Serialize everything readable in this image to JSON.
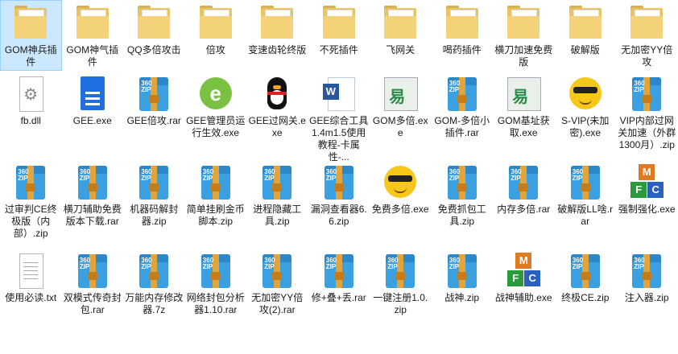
{
  "files": [
    {
      "label": "GOM神兵插件",
      "icon": "folder-icon",
      "selected": true
    },
    {
      "label": "GOM神气插件",
      "icon": "folder-icon",
      "selected": false
    },
    {
      "label": "QQ多倍攻击",
      "icon": "folder-icon",
      "selected": false
    },
    {
      "label": "倍攻",
      "icon": "folder-icon",
      "selected": false
    },
    {
      "label": "变速齿轮终版",
      "icon": "folder-icon",
      "selected": false
    },
    {
      "label": "不死插件",
      "icon": "folder-icon",
      "selected": false
    },
    {
      "label": "飞网关",
      "icon": "folder-icon",
      "selected": false
    },
    {
      "label": "喝药插件",
      "icon": "folder-icon",
      "selected": false
    },
    {
      "label": "横刀加速免费版",
      "icon": "folder-icon",
      "selected": false
    },
    {
      "label": "破解版",
      "icon": "folder-icon",
      "selected": false
    },
    {
      "label": "无加密YY倍攻",
      "icon": "folder-icon",
      "selected": false
    },
    {
      "label": "fb.dll",
      "icon": "dll-file-icon",
      "selected": false
    },
    {
      "label": "GEE.exe",
      "icon": "document-icon",
      "selected": false
    },
    {
      "label": "GEE倍攻.rar",
      "icon": "zip-archive-icon",
      "selected": false
    },
    {
      "label": "GEE管理员运行生效.exe",
      "icon": "gee-app-icon",
      "selected": false
    },
    {
      "label": "GEE过网关.exe",
      "icon": "qq-penguin-icon",
      "selected": false
    },
    {
      "label": "GEE综合工具1.4m1.5使用教程-卡属性-...",
      "icon": "word-document-icon",
      "selected": false
    },
    {
      "label": "GOM多倍.exe",
      "icon": "stamp-app-icon",
      "selected": false
    },
    {
      "label": "GOM-多倍小插件.rar",
      "icon": "zip-archive-icon",
      "selected": false
    },
    {
      "label": "GOM基址获取.exe",
      "icon": "stamp-app-icon",
      "selected": false
    },
    {
      "label": "S-VIP(未加密).exe",
      "icon": "smiley-icon",
      "selected": false
    },
    {
      "label": "VIP内部过网关加速（外群1300月）.zip",
      "icon": "zip-archive-icon",
      "selected": false
    },
    {
      "label": "过审判CE终极版（内部）.zip",
      "icon": "zip-archive-icon",
      "selected": false
    },
    {
      "label": "横刀辅助免费版本下载.rar",
      "icon": "zip-archive-icon",
      "selected": false
    },
    {
      "label": "机器码解封器.zip",
      "icon": "zip-archive-icon",
      "selected": false
    },
    {
      "label": "简单挂刷金币脚本.zip",
      "icon": "zip-archive-icon",
      "selected": false
    },
    {
      "label": "进程隐藏工具.zip",
      "icon": "zip-archive-icon",
      "selected": false
    },
    {
      "label": "漏洞查看器6.6.zip",
      "icon": "zip-archive-icon",
      "selected": false
    },
    {
      "label": "免费多倍.exe",
      "icon": "smiley-icon",
      "selected": false
    },
    {
      "label": "免费抓包工具.zip",
      "icon": "zip-archive-icon",
      "selected": false
    },
    {
      "label": "内存多倍.rar",
      "icon": "zip-archive-icon",
      "selected": false
    },
    {
      "label": "破解版LL啥.rar",
      "icon": "zip-archive-icon",
      "selected": false
    },
    {
      "label": "强制强化.exe",
      "icon": "mfc-app-icon",
      "selected": false
    },
    {
      "label": "使用必读.txt",
      "icon": "text-file-icon",
      "selected": false
    },
    {
      "label": "双模式传奇封包.rar",
      "icon": "zip-archive-icon",
      "selected": false
    },
    {
      "label": "万能内存修改器.7z",
      "icon": "zip-archive-icon",
      "selected": false
    },
    {
      "label": "网络封包分析器1.10.rar",
      "icon": "zip-archive-icon",
      "selected": false
    },
    {
      "label": "无加密YY倍攻(2).rar",
      "icon": "zip-archive-icon",
      "selected": false
    },
    {
      "label": "修+叠+丢.rar",
      "icon": "zip-archive-icon",
      "selected": false
    },
    {
      "label": "一键注册1.0.zip",
      "icon": "zip-archive-icon",
      "selected": false
    },
    {
      "label": "战神.zip",
      "icon": "zip-archive-icon",
      "selected": false
    },
    {
      "label": "战神辅助.exe",
      "icon": "mfc-app-icon",
      "selected": false
    },
    {
      "label": "终极CE.zip",
      "icon": "zip-archive-icon",
      "selected": false
    },
    {
      "label": "注入器.zip",
      "icon": "zip-archive-icon",
      "selected": false
    }
  ],
  "zip_badge": "360 ZIP",
  "colors": {
    "selection": "#cce8ff",
    "folder": "#f3d27a",
    "zip": "#3aa0e0"
  }
}
